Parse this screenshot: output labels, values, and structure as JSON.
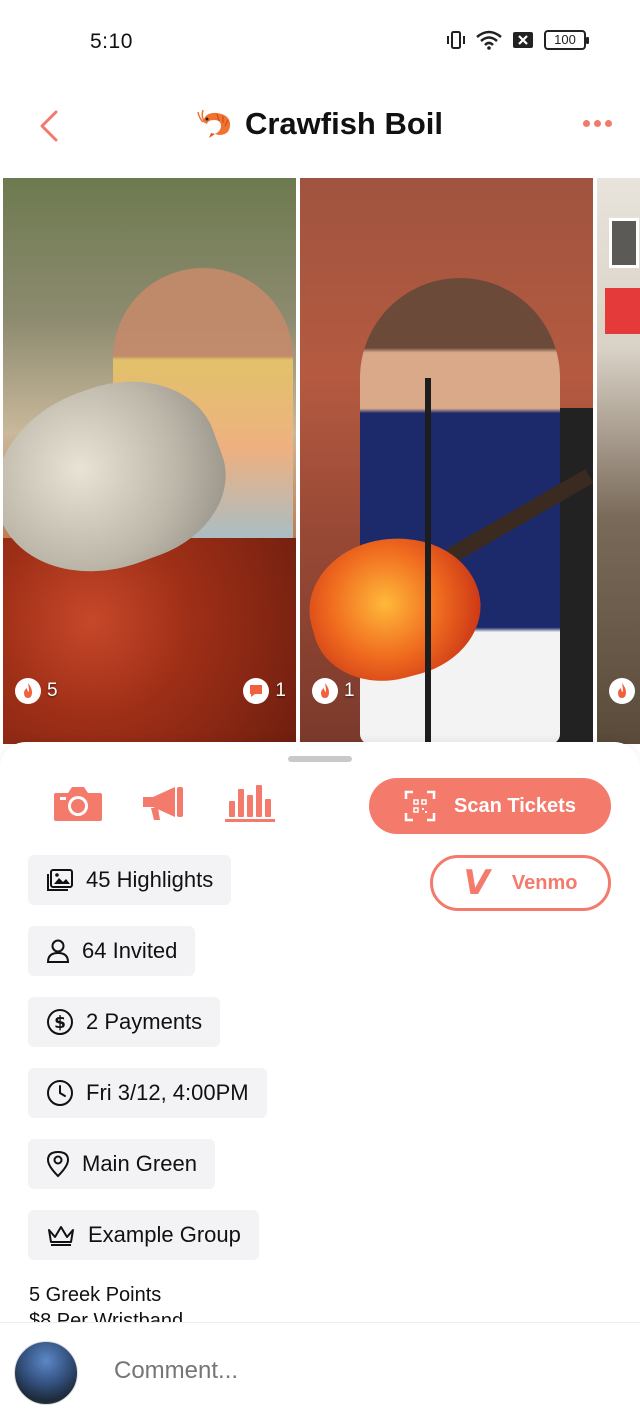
{
  "status_bar": {
    "time": "5:10",
    "battery": "100"
  },
  "header": {
    "title": "Crawfish Boil"
  },
  "photos": [
    {
      "likes": "5",
      "comments": "1"
    },
    {
      "likes": "1"
    },
    {
      "likes": ""
    }
  ],
  "actions": {
    "scan_label": "Scan Tickets",
    "venmo_label": "Venmo"
  },
  "details": {
    "highlights": "45 Highlights",
    "invited": "64 Invited",
    "payments": "2 Payments",
    "datetime": "Fri 3/12, 4:00PM",
    "location": "Main Green",
    "group": "Example Group"
  },
  "extra_lines": [
    "5 Greek Points",
    "$8 Per Wristband"
  ],
  "comment": {
    "placeholder": "Comment..."
  },
  "colors": {
    "accent": "#f47a6c"
  }
}
